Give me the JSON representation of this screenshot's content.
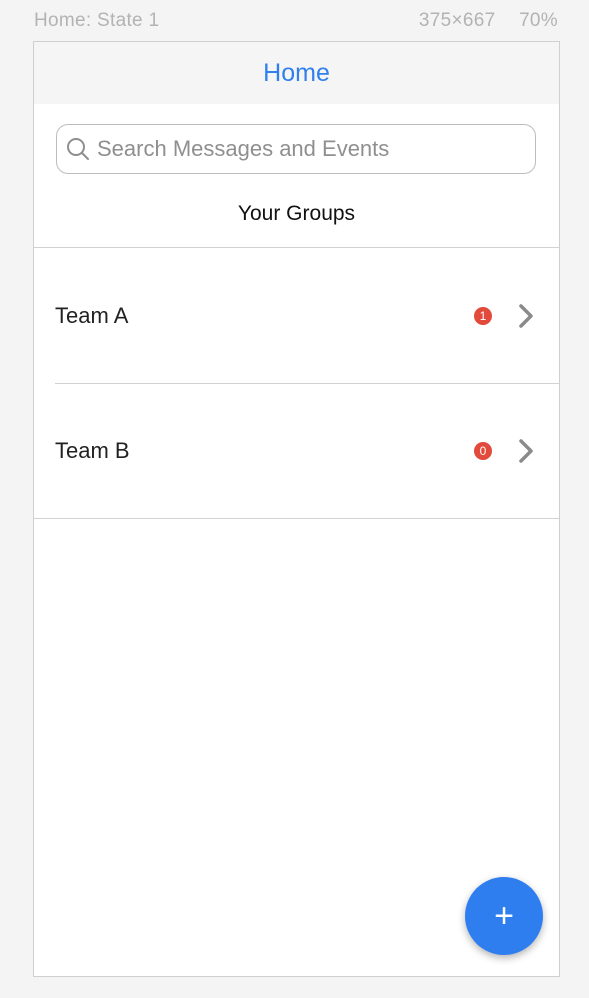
{
  "artboard": {
    "name": "Home: State 1",
    "size": "375×667",
    "zoom": "70%"
  },
  "navbar": {
    "title": "Home"
  },
  "search": {
    "placeholder": "Search Messages and Events",
    "value": "",
    "icon": "search-icon"
  },
  "groups": {
    "title": "Your Groups",
    "items": [
      {
        "name": "Team A",
        "badge": "1"
      },
      {
        "name": "Team B",
        "badge": "0"
      }
    ]
  },
  "fab": {
    "label": "+"
  },
  "colors": {
    "accent": "#2f80ed",
    "badge": "#e24a3b",
    "fab": "#2f7ef0"
  }
}
